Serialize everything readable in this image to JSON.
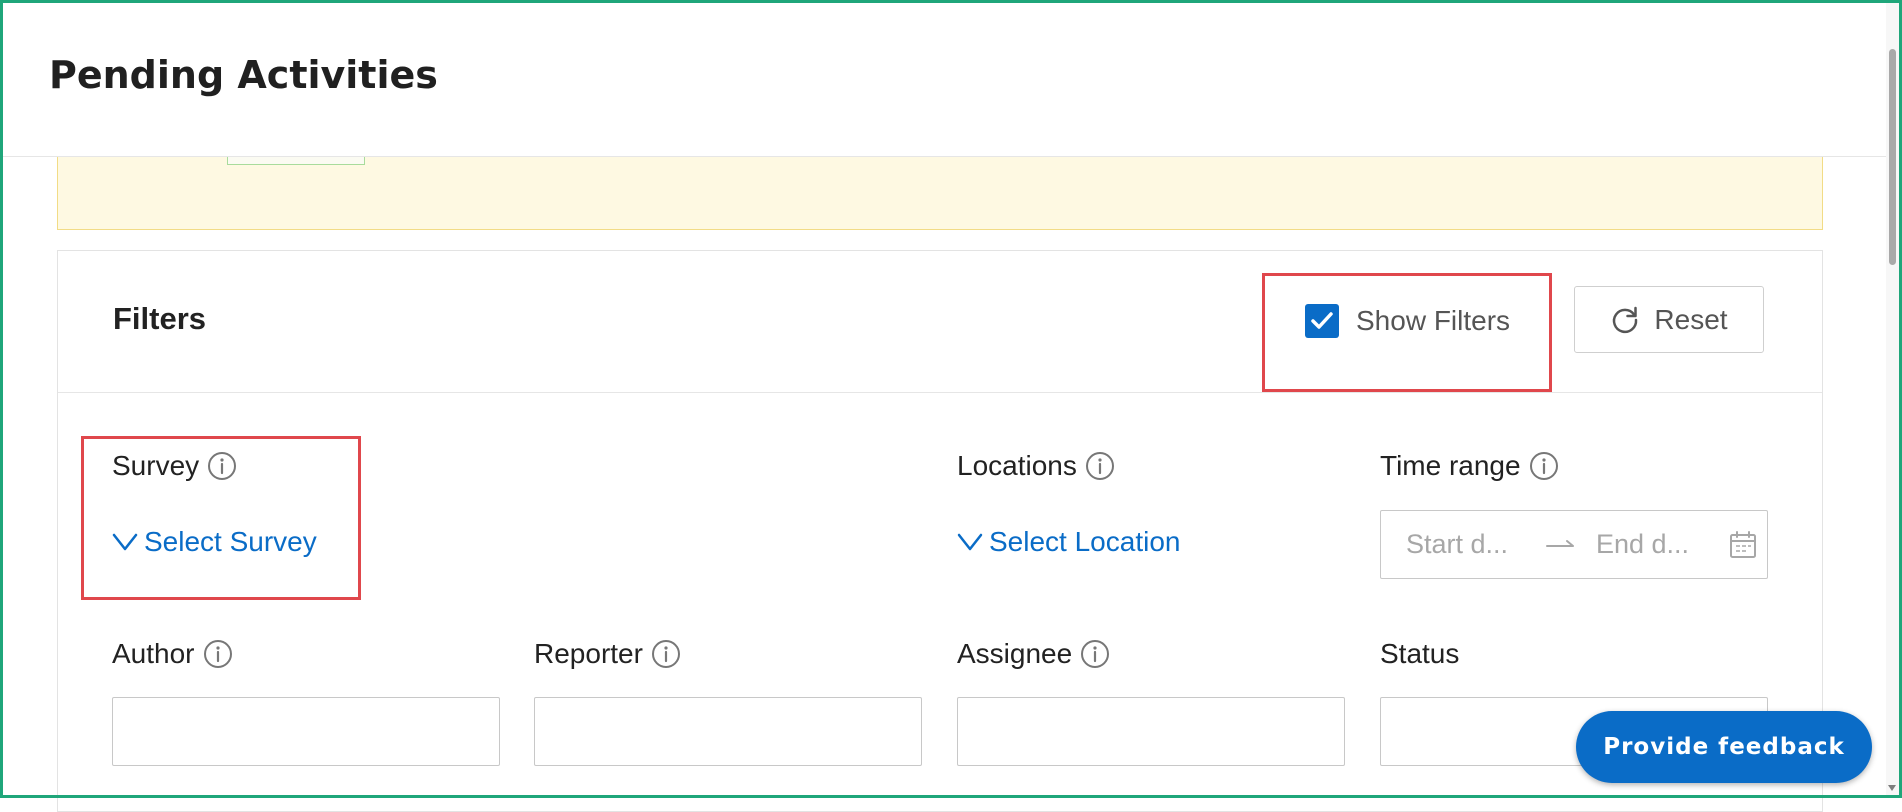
{
  "header": {
    "title": "Pending Activities"
  },
  "filters": {
    "title": "Filters",
    "show_filters_label": "Show Filters",
    "show_filters_checked": true,
    "reset_label": "Reset",
    "survey": {
      "label": "Survey",
      "select_text": "Select Survey"
    },
    "locations": {
      "label": "Locations",
      "select_text": "Select Location"
    },
    "time_range": {
      "label": "Time range",
      "start_placeholder": "Start d...",
      "end_placeholder": "End d..."
    },
    "author": {
      "label": "Author",
      "value": ""
    },
    "reporter": {
      "label": "Reporter",
      "value": ""
    },
    "assignee": {
      "label": "Assignee",
      "value": ""
    },
    "status": {
      "label": "Status",
      "value": ""
    }
  },
  "feedback": {
    "label": "Provide feedback"
  },
  "icons": {
    "checkbox": "check-icon",
    "reset": "refresh-icon",
    "info": "info-icon",
    "dropdown": "chevron-down-icon",
    "range_separator": "arrow-right-icon",
    "calendar": "calendar-icon"
  },
  "colors": {
    "accent": "#0a6cc7",
    "highlight": "#e0474c",
    "banner_background": "#fef9e2",
    "frame": "#1fa67a"
  }
}
